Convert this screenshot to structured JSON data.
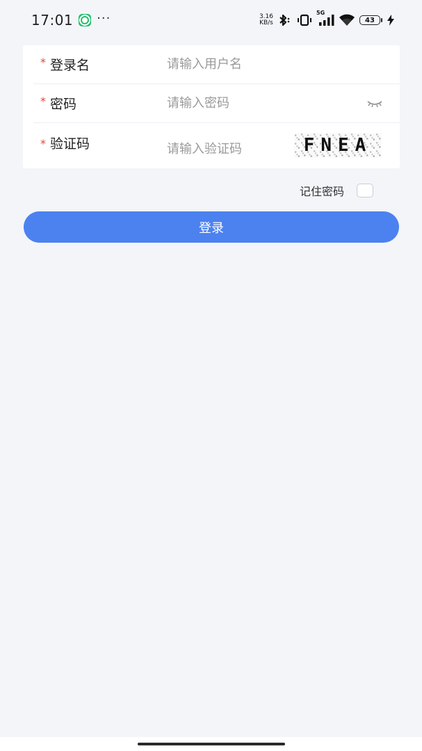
{
  "status_bar": {
    "time": "17:01",
    "more": "···",
    "net_speed_value": "3.16",
    "net_speed_unit": "KB/s",
    "network_type": "5G",
    "battery_level": "43",
    "icons": [
      "app-notification-icon",
      "bluetooth-icon",
      "vibrate-icon",
      "signal-icon",
      "wifi-icon",
      "battery-icon",
      "charging-icon"
    ]
  },
  "form": {
    "required_mark": "*",
    "username": {
      "label": "登录名",
      "placeholder": "请输入用户名",
      "value": ""
    },
    "password": {
      "label": "密码",
      "placeholder": "请输入密码",
      "value": "",
      "toggle_icon": "eye-closed-icon"
    },
    "captcha": {
      "label": "验证码",
      "placeholder": "请输入验证码",
      "value": "",
      "image_text": "FNEA"
    }
  },
  "remember": {
    "label": "记住密码",
    "checked": false
  },
  "login_button": {
    "label": "登录",
    "color": "#4b82ef"
  },
  "colors": {
    "background": "#f3f5f9",
    "card": "#ffffff",
    "required": "#e04a3c",
    "primary": "#4b82ef"
  }
}
